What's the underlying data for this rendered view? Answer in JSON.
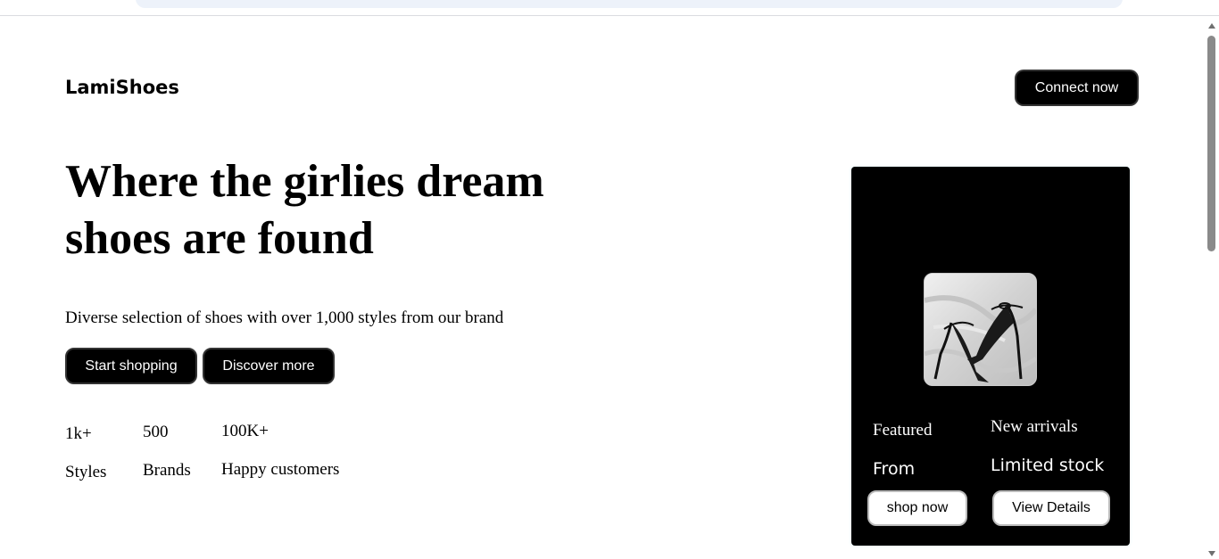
{
  "header": {
    "logo": "LamiShoes",
    "connect_label": "Connect now"
  },
  "hero": {
    "title": "Where the girlies dream shoes are found",
    "description": "Diverse selection of shoes with over 1,000 styles from our brand",
    "start_label": "Start shopping",
    "discover_label": "Discover more"
  },
  "stats": [
    {
      "value": "1k+",
      "label": "Styles"
    },
    {
      "value": "500",
      "label": "Brands"
    },
    {
      "value": "100K+",
      "label": "Happy customers"
    }
  ],
  "card": {
    "featured": "Featured",
    "from": "From",
    "new_arrivals": "New arrivals",
    "limited_stock": "Limited stock",
    "shop_label": "shop now",
    "details_label": "View Details"
  }
}
